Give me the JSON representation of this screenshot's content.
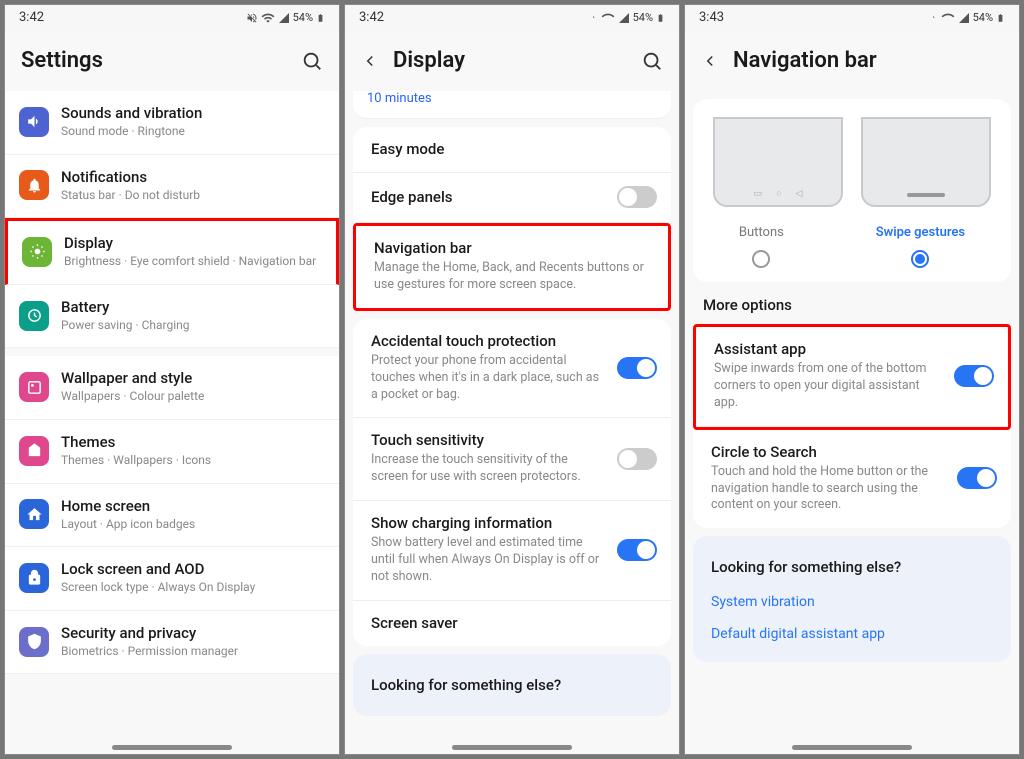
{
  "panel1": {
    "status": {
      "time": "3:42",
      "battery": "54%"
    },
    "title": "Settings",
    "items": [
      {
        "title": "Sounds and vibration",
        "sub": "Sound mode · Ringtone",
        "icon": "sound",
        "color": "#4d63d1"
      },
      {
        "title": "Notifications",
        "sub": "Status bar · Do not disturb",
        "icon": "bell",
        "color": "#e85a1a"
      },
      {
        "title": "Display",
        "sub": "Brightness · Eye comfort shield · Navigation bar",
        "icon": "sun",
        "color": "#6cb536",
        "highlight": true
      },
      {
        "title": "Battery",
        "sub": "Power saving · Charging",
        "icon": "battery",
        "color": "#0b9f8a"
      },
      {
        "title": "Wallpaper and style",
        "sub": "Wallpapers · Colour palette",
        "icon": "wallpaper",
        "color": "#e0488e"
      },
      {
        "title": "Themes",
        "sub": "Themes · Wallpapers · Icons",
        "icon": "themes",
        "color": "#e0488e"
      },
      {
        "title": "Home screen",
        "sub": "Layout · App icon badges",
        "icon": "home",
        "color": "#2a66d9"
      },
      {
        "title": "Lock screen and AOD",
        "sub": "Screen lock type · Always On Display",
        "icon": "lock",
        "color": "#2a66d9"
      },
      {
        "title": "Security and privacy",
        "sub": "Biometrics · Permission manager",
        "icon": "shield",
        "color": "#6b6fc9"
      }
    ]
  },
  "panel2": {
    "status": {
      "time": "3:42",
      "battery": "54%"
    },
    "title": "Display",
    "screen_timeout_value": "10 minutes",
    "items": [
      {
        "title": "Easy mode"
      },
      {
        "title": "Edge panels",
        "toggle": "off"
      },
      {
        "title": "Navigation bar",
        "desc": "Manage the Home, Back, and Recents buttons or use gestures for more screen space.",
        "highlight": true
      },
      {
        "title": "Accidental touch protection",
        "desc": "Protect your phone from accidental touches when it's in a dark place, such as a pocket or bag.",
        "toggle": "on"
      },
      {
        "title": "Touch sensitivity",
        "desc": "Increase the touch sensitivity of the screen for use with screen protectors.",
        "toggle": "off"
      },
      {
        "title": "Show charging information",
        "desc": "Show battery level and estimated time until full when Always On Display is off or not shown.",
        "toggle": "on"
      },
      {
        "title": "Screen saver"
      }
    ],
    "footer_prompt": "Looking for something else?"
  },
  "panel3": {
    "status": {
      "time": "3:43",
      "battery": "54%"
    },
    "title": "Navigation bar",
    "choices": {
      "buttons": "Buttons",
      "swipe": "Swipe gestures"
    },
    "more_options": "More options",
    "items": [
      {
        "title": "Assistant app",
        "desc": "Swipe inwards from one of the bottom corners to open your digital assistant app.",
        "toggle": "on",
        "highlight": true
      },
      {
        "title": "Circle to Search",
        "desc": "Touch and hold the Home button or the navigation handle to search using the content on your screen.",
        "toggle": "on"
      }
    ],
    "footer_prompt": "Looking for something else?",
    "footer_links": [
      "System vibration",
      "Default digital assistant app"
    ]
  }
}
